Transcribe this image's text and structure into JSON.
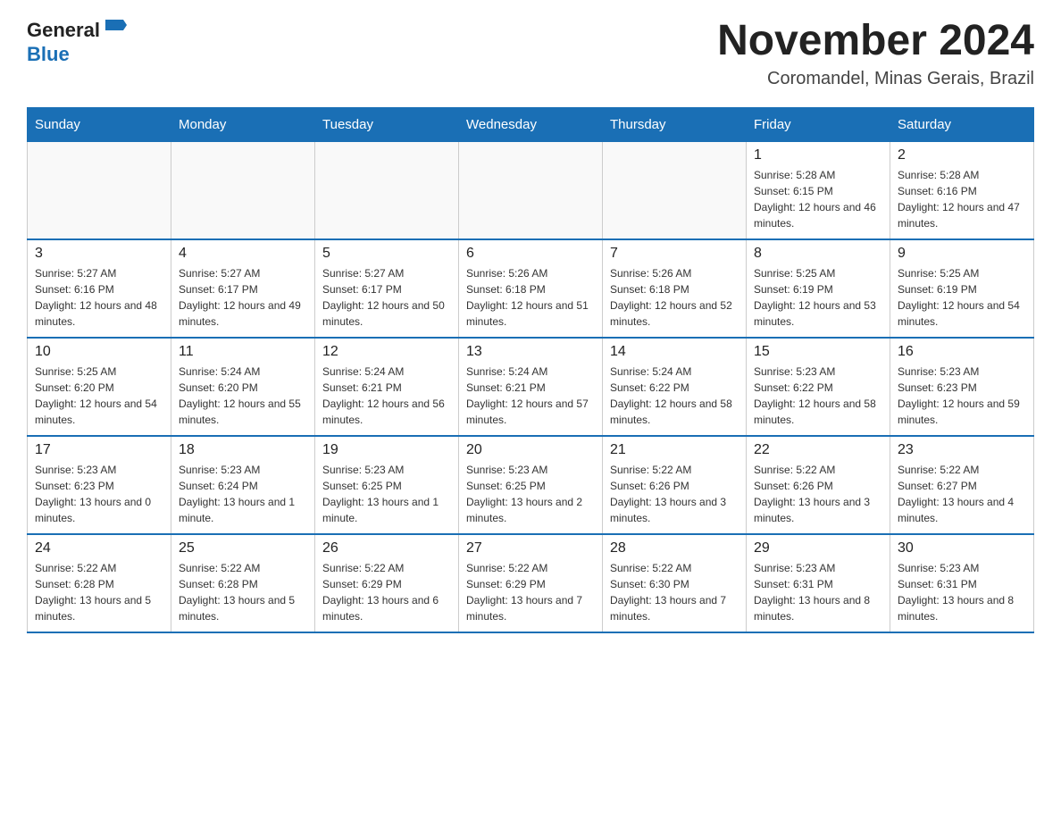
{
  "logo": {
    "text_general": "General",
    "text_blue": "Blue"
  },
  "title": "November 2024",
  "subtitle": "Coromandel, Minas Gerais, Brazil",
  "days_of_week": [
    "Sunday",
    "Monday",
    "Tuesday",
    "Wednesday",
    "Thursday",
    "Friday",
    "Saturday"
  ],
  "weeks": [
    [
      {
        "day": "",
        "info": ""
      },
      {
        "day": "",
        "info": ""
      },
      {
        "day": "",
        "info": ""
      },
      {
        "day": "",
        "info": ""
      },
      {
        "day": "",
        "info": ""
      },
      {
        "day": "1",
        "info": "Sunrise: 5:28 AM\nSunset: 6:15 PM\nDaylight: 12 hours and 46 minutes."
      },
      {
        "day": "2",
        "info": "Sunrise: 5:28 AM\nSunset: 6:16 PM\nDaylight: 12 hours and 47 minutes."
      }
    ],
    [
      {
        "day": "3",
        "info": "Sunrise: 5:27 AM\nSunset: 6:16 PM\nDaylight: 12 hours and 48 minutes."
      },
      {
        "day": "4",
        "info": "Sunrise: 5:27 AM\nSunset: 6:17 PM\nDaylight: 12 hours and 49 minutes."
      },
      {
        "day": "5",
        "info": "Sunrise: 5:27 AM\nSunset: 6:17 PM\nDaylight: 12 hours and 50 minutes."
      },
      {
        "day": "6",
        "info": "Sunrise: 5:26 AM\nSunset: 6:18 PM\nDaylight: 12 hours and 51 minutes."
      },
      {
        "day": "7",
        "info": "Sunrise: 5:26 AM\nSunset: 6:18 PM\nDaylight: 12 hours and 52 minutes."
      },
      {
        "day": "8",
        "info": "Sunrise: 5:25 AM\nSunset: 6:19 PM\nDaylight: 12 hours and 53 minutes."
      },
      {
        "day": "9",
        "info": "Sunrise: 5:25 AM\nSunset: 6:19 PM\nDaylight: 12 hours and 54 minutes."
      }
    ],
    [
      {
        "day": "10",
        "info": "Sunrise: 5:25 AM\nSunset: 6:20 PM\nDaylight: 12 hours and 54 minutes."
      },
      {
        "day": "11",
        "info": "Sunrise: 5:24 AM\nSunset: 6:20 PM\nDaylight: 12 hours and 55 minutes."
      },
      {
        "day": "12",
        "info": "Sunrise: 5:24 AM\nSunset: 6:21 PM\nDaylight: 12 hours and 56 minutes."
      },
      {
        "day": "13",
        "info": "Sunrise: 5:24 AM\nSunset: 6:21 PM\nDaylight: 12 hours and 57 minutes."
      },
      {
        "day": "14",
        "info": "Sunrise: 5:24 AM\nSunset: 6:22 PM\nDaylight: 12 hours and 58 minutes."
      },
      {
        "day": "15",
        "info": "Sunrise: 5:23 AM\nSunset: 6:22 PM\nDaylight: 12 hours and 58 minutes."
      },
      {
        "day": "16",
        "info": "Sunrise: 5:23 AM\nSunset: 6:23 PM\nDaylight: 12 hours and 59 minutes."
      }
    ],
    [
      {
        "day": "17",
        "info": "Sunrise: 5:23 AM\nSunset: 6:23 PM\nDaylight: 13 hours and 0 minutes."
      },
      {
        "day": "18",
        "info": "Sunrise: 5:23 AM\nSunset: 6:24 PM\nDaylight: 13 hours and 1 minute."
      },
      {
        "day": "19",
        "info": "Sunrise: 5:23 AM\nSunset: 6:25 PM\nDaylight: 13 hours and 1 minute."
      },
      {
        "day": "20",
        "info": "Sunrise: 5:23 AM\nSunset: 6:25 PM\nDaylight: 13 hours and 2 minutes."
      },
      {
        "day": "21",
        "info": "Sunrise: 5:22 AM\nSunset: 6:26 PM\nDaylight: 13 hours and 3 minutes."
      },
      {
        "day": "22",
        "info": "Sunrise: 5:22 AM\nSunset: 6:26 PM\nDaylight: 13 hours and 3 minutes."
      },
      {
        "day": "23",
        "info": "Sunrise: 5:22 AM\nSunset: 6:27 PM\nDaylight: 13 hours and 4 minutes."
      }
    ],
    [
      {
        "day": "24",
        "info": "Sunrise: 5:22 AM\nSunset: 6:28 PM\nDaylight: 13 hours and 5 minutes."
      },
      {
        "day": "25",
        "info": "Sunrise: 5:22 AM\nSunset: 6:28 PM\nDaylight: 13 hours and 5 minutes."
      },
      {
        "day": "26",
        "info": "Sunrise: 5:22 AM\nSunset: 6:29 PM\nDaylight: 13 hours and 6 minutes."
      },
      {
        "day": "27",
        "info": "Sunrise: 5:22 AM\nSunset: 6:29 PM\nDaylight: 13 hours and 7 minutes."
      },
      {
        "day": "28",
        "info": "Sunrise: 5:22 AM\nSunset: 6:30 PM\nDaylight: 13 hours and 7 minutes."
      },
      {
        "day": "29",
        "info": "Sunrise: 5:23 AM\nSunset: 6:31 PM\nDaylight: 13 hours and 8 minutes."
      },
      {
        "day": "30",
        "info": "Sunrise: 5:23 AM\nSunset: 6:31 PM\nDaylight: 13 hours and 8 minutes."
      }
    ]
  ]
}
